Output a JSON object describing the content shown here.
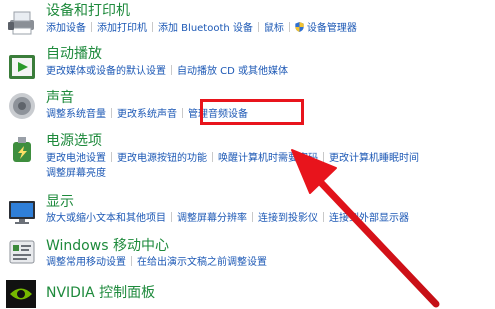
{
  "categories": [
    {
      "title": "设备和打印机",
      "links": [
        "添加设备",
        "添加打印机",
        "添加 Bluetooth 设备",
        "鼠标",
        "设备管理器"
      ]
    },
    {
      "title": "自动播放",
      "links": [
        "更改媒体或设备的默认设置",
        "自动播放 CD 或其他媒体"
      ]
    },
    {
      "title": "声音",
      "links": [
        "调整系统音量",
        "更改系统声音",
        "管理音频设备"
      ]
    },
    {
      "title": "电源选项",
      "links": [
        "更改电池设置",
        "更改电源按钮的功能",
        "唤醒计算机时需要密码",
        "更改计算机睡眠时间"
      ],
      "links2": [
        "调整屏幕亮度"
      ]
    },
    {
      "title": "显示",
      "links": [
        "放大或缩小文本和其他项目",
        "调整屏幕分辨率",
        "连接到投影仪",
        "连接到外部显示器"
      ]
    },
    {
      "title": "Windows 移动中心",
      "links": [
        "调整常用移动设置",
        "在给出演示文稿之前调整设置"
      ]
    },
    {
      "title": "NVIDIA 控制面板",
      "links": []
    }
  ],
  "annotation": {
    "highlight_color": "#e8141c",
    "highlighted_link": "管理音频设备"
  },
  "icons": [
    "printer-icon",
    "autoplay-icon",
    "speaker-icon",
    "power-icon",
    "monitor-icon",
    "mobility-center-icon",
    "nvidia-icon"
  ]
}
